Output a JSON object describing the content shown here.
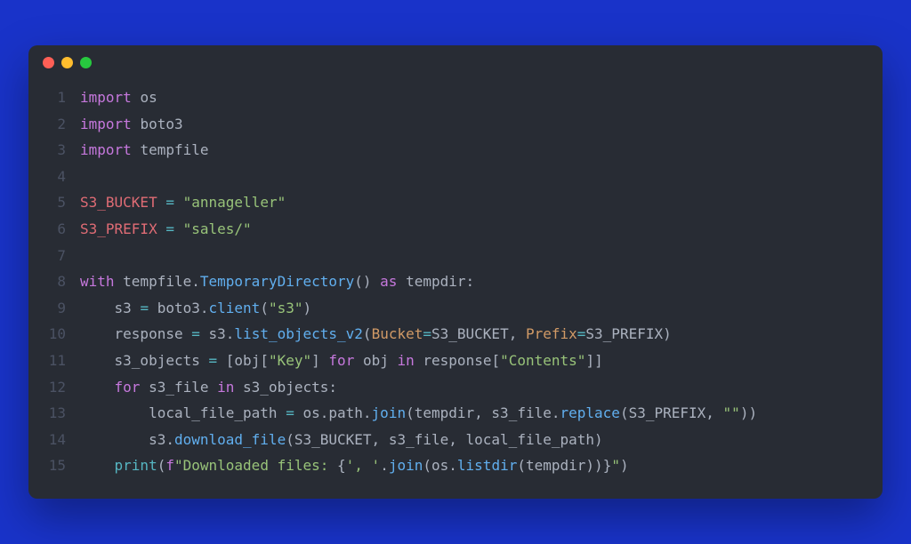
{
  "window": {
    "traffic": [
      "red",
      "yellow",
      "green"
    ]
  },
  "colors": {
    "bg_page": "#1933c9",
    "bg_window": "#282c34",
    "gutter": "#4b5263",
    "default": "#abb2bf",
    "keyword": "#c678dd",
    "operator": "#56b6c2",
    "variable": "#e06c75",
    "string": "#98c379",
    "function": "#61afef",
    "builtin": "#56b6c2",
    "attr": "#d19a66"
  },
  "code": {
    "lines": [
      {
        "n": "1",
        "t": [
          [
            "kw",
            "import"
          ],
          [
            "plain",
            " "
          ],
          [
            "mod",
            "os"
          ]
        ]
      },
      {
        "n": "2",
        "t": [
          [
            "kw",
            "import"
          ],
          [
            "plain",
            " "
          ],
          [
            "mod",
            "boto3"
          ]
        ]
      },
      {
        "n": "3",
        "t": [
          [
            "kw",
            "import"
          ],
          [
            "plain",
            " "
          ],
          [
            "mod",
            "tempfile"
          ]
        ]
      },
      {
        "n": "4",
        "t": []
      },
      {
        "n": "5",
        "t": [
          [
            "var",
            "S3_BUCKET"
          ],
          [
            "plain",
            " "
          ],
          [
            "op",
            "="
          ],
          [
            "plain",
            " "
          ],
          [
            "str",
            "\"annageller\""
          ]
        ]
      },
      {
        "n": "6",
        "t": [
          [
            "var",
            "S3_PREFIX"
          ],
          [
            "plain",
            " "
          ],
          [
            "op",
            "="
          ],
          [
            "plain",
            " "
          ],
          [
            "str",
            "\"sales/\""
          ]
        ]
      },
      {
        "n": "7",
        "t": []
      },
      {
        "n": "8",
        "t": [
          [
            "kw",
            "with"
          ],
          [
            "plain",
            " "
          ],
          [
            "plain",
            "tempfile"
          ],
          [
            "punc",
            "."
          ],
          [
            "fn",
            "TemporaryDirectory"
          ],
          [
            "punc",
            "()"
          ],
          [
            "plain",
            " "
          ],
          [
            "kw",
            "as"
          ],
          [
            "plain",
            " "
          ],
          [
            "plain",
            "tempdir"
          ],
          [
            "punc",
            ":"
          ]
        ]
      },
      {
        "n": "9",
        "t": [
          [
            "plain",
            "    "
          ],
          [
            "plain",
            "s3 "
          ],
          [
            "op",
            "="
          ],
          [
            "plain",
            " boto3"
          ],
          [
            "punc",
            "."
          ],
          [
            "fn",
            "client"
          ],
          [
            "punc",
            "("
          ],
          [
            "str",
            "\"s3\""
          ],
          [
            "punc",
            ")"
          ]
        ]
      },
      {
        "n": "10",
        "t": [
          [
            "plain",
            "    "
          ],
          [
            "plain",
            "response "
          ],
          [
            "op",
            "="
          ],
          [
            "plain",
            " s3"
          ],
          [
            "punc",
            "."
          ],
          [
            "fn",
            "list_objects_v2"
          ],
          [
            "punc",
            "("
          ],
          [
            "attr",
            "Bucket"
          ],
          [
            "op",
            "="
          ],
          [
            "plain",
            "S3_BUCKET"
          ],
          [
            "punc",
            ", "
          ],
          [
            "attr",
            "Prefix"
          ],
          [
            "op",
            "="
          ],
          [
            "plain",
            "S3_PREFIX"
          ],
          [
            "punc",
            ")"
          ]
        ]
      },
      {
        "n": "11",
        "t": [
          [
            "plain",
            "    "
          ],
          [
            "plain",
            "s3_objects "
          ],
          [
            "op",
            "="
          ],
          [
            "plain",
            " "
          ],
          [
            "punc",
            "["
          ],
          [
            "plain",
            "obj"
          ],
          [
            "punc",
            "["
          ],
          [
            "str",
            "\"Key\""
          ],
          [
            "punc",
            "]"
          ],
          [
            "plain",
            " "
          ],
          [
            "kw",
            "for"
          ],
          [
            "plain",
            " obj "
          ],
          [
            "kw",
            "in"
          ],
          [
            "plain",
            " response"
          ],
          [
            "punc",
            "["
          ],
          [
            "str",
            "\"Contents\""
          ],
          [
            "punc",
            "]]"
          ]
        ]
      },
      {
        "n": "12",
        "t": [
          [
            "plain",
            "    "
          ],
          [
            "kw",
            "for"
          ],
          [
            "plain",
            " s3_file "
          ],
          [
            "kw",
            "in"
          ],
          [
            "plain",
            " s3_objects"
          ],
          [
            "punc",
            ":"
          ]
        ]
      },
      {
        "n": "13",
        "t": [
          [
            "plain",
            "        "
          ],
          [
            "plain",
            "local_file_path "
          ],
          [
            "op",
            "="
          ],
          [
            "plain",
            " os"
          ],
          [
            "punc",
            "."
          ],
          [
            "plain",
            "path"
          ],
          [
            "punc",
            "."
          ],
          [
            "fn",
            "join"
          ],
          [
            "punc",
            "("
          ],
          [
            "plain",
            "tempdir"
          ],
          [
            "punc",
            ", "
          ],
          [
            "plain",
            "s3_file"
          ],
          [
            "punc",
            "."
          ],
          [
            "fn",
            "replace"
          ],
          [
            "punc",
            "("
          ],
          [
            "plain",
            "S3_PREFIX"
          ],
          [
            "punc",
            ", "
          ],
          [
            "str",
            "\"\""
          ],
          [
            "punc",
            "))"
          ]
        ]
      },
      {
        "n": "14",
        "t": [
          [
            "plain",
            "        "
          ],
          [
            "plain",
            "s3"
          ],
          [
            "punc",
            "."
          ],
          [
            "fn",
            "download_file"
          ],
          [
            "punc",
            "("
          ],
          [
            "plain",
            "S3_BUCKET"
          ],
          [
            "punc",
            ", "
          ],
          [
            "plain",
            "s3_file"
          ],
          [
            "punc",
            ", "
          ],
          [
            "plain",
            "local_file_path"
          ],
          [
            "punc",
            ")"
          ]
        ]
      },
      {
        "n": "15",
        "t": [
          [
            "plain",
            "    "
          ],
          [
            "builtin",
            "print"
          ],
          [
            "punc",
            "("
          ],
          [
            "kw",
            "f"
          ],
          [
            "str",
            "\"Downloaded files: "
          ],
          [
            "punc",
            "{"
          ],
          [
            "str",
            "', '"
          ],
          [
            "punc",
            "."
          ],
          [
            "fn",
            "join"
          ],
          [
            "punc",
            "("
          ],
          [
            "plain",
            "os"
          ],
          [
            "punc",
            "."
          ],
          [
            "fn",
            "listdir"
          ],
          [
            "punc",
            "("
          ],
          [
            "plain",
            "tempdir"
          ],
          [
            "punc",
            "))"
          ],
          [
            "punc",
            "}"
          ],
          [
            "str",
            "\""
          ],
          [
            "punc",
            ")"
          ]
        ]
      }
    ]
  }
}
